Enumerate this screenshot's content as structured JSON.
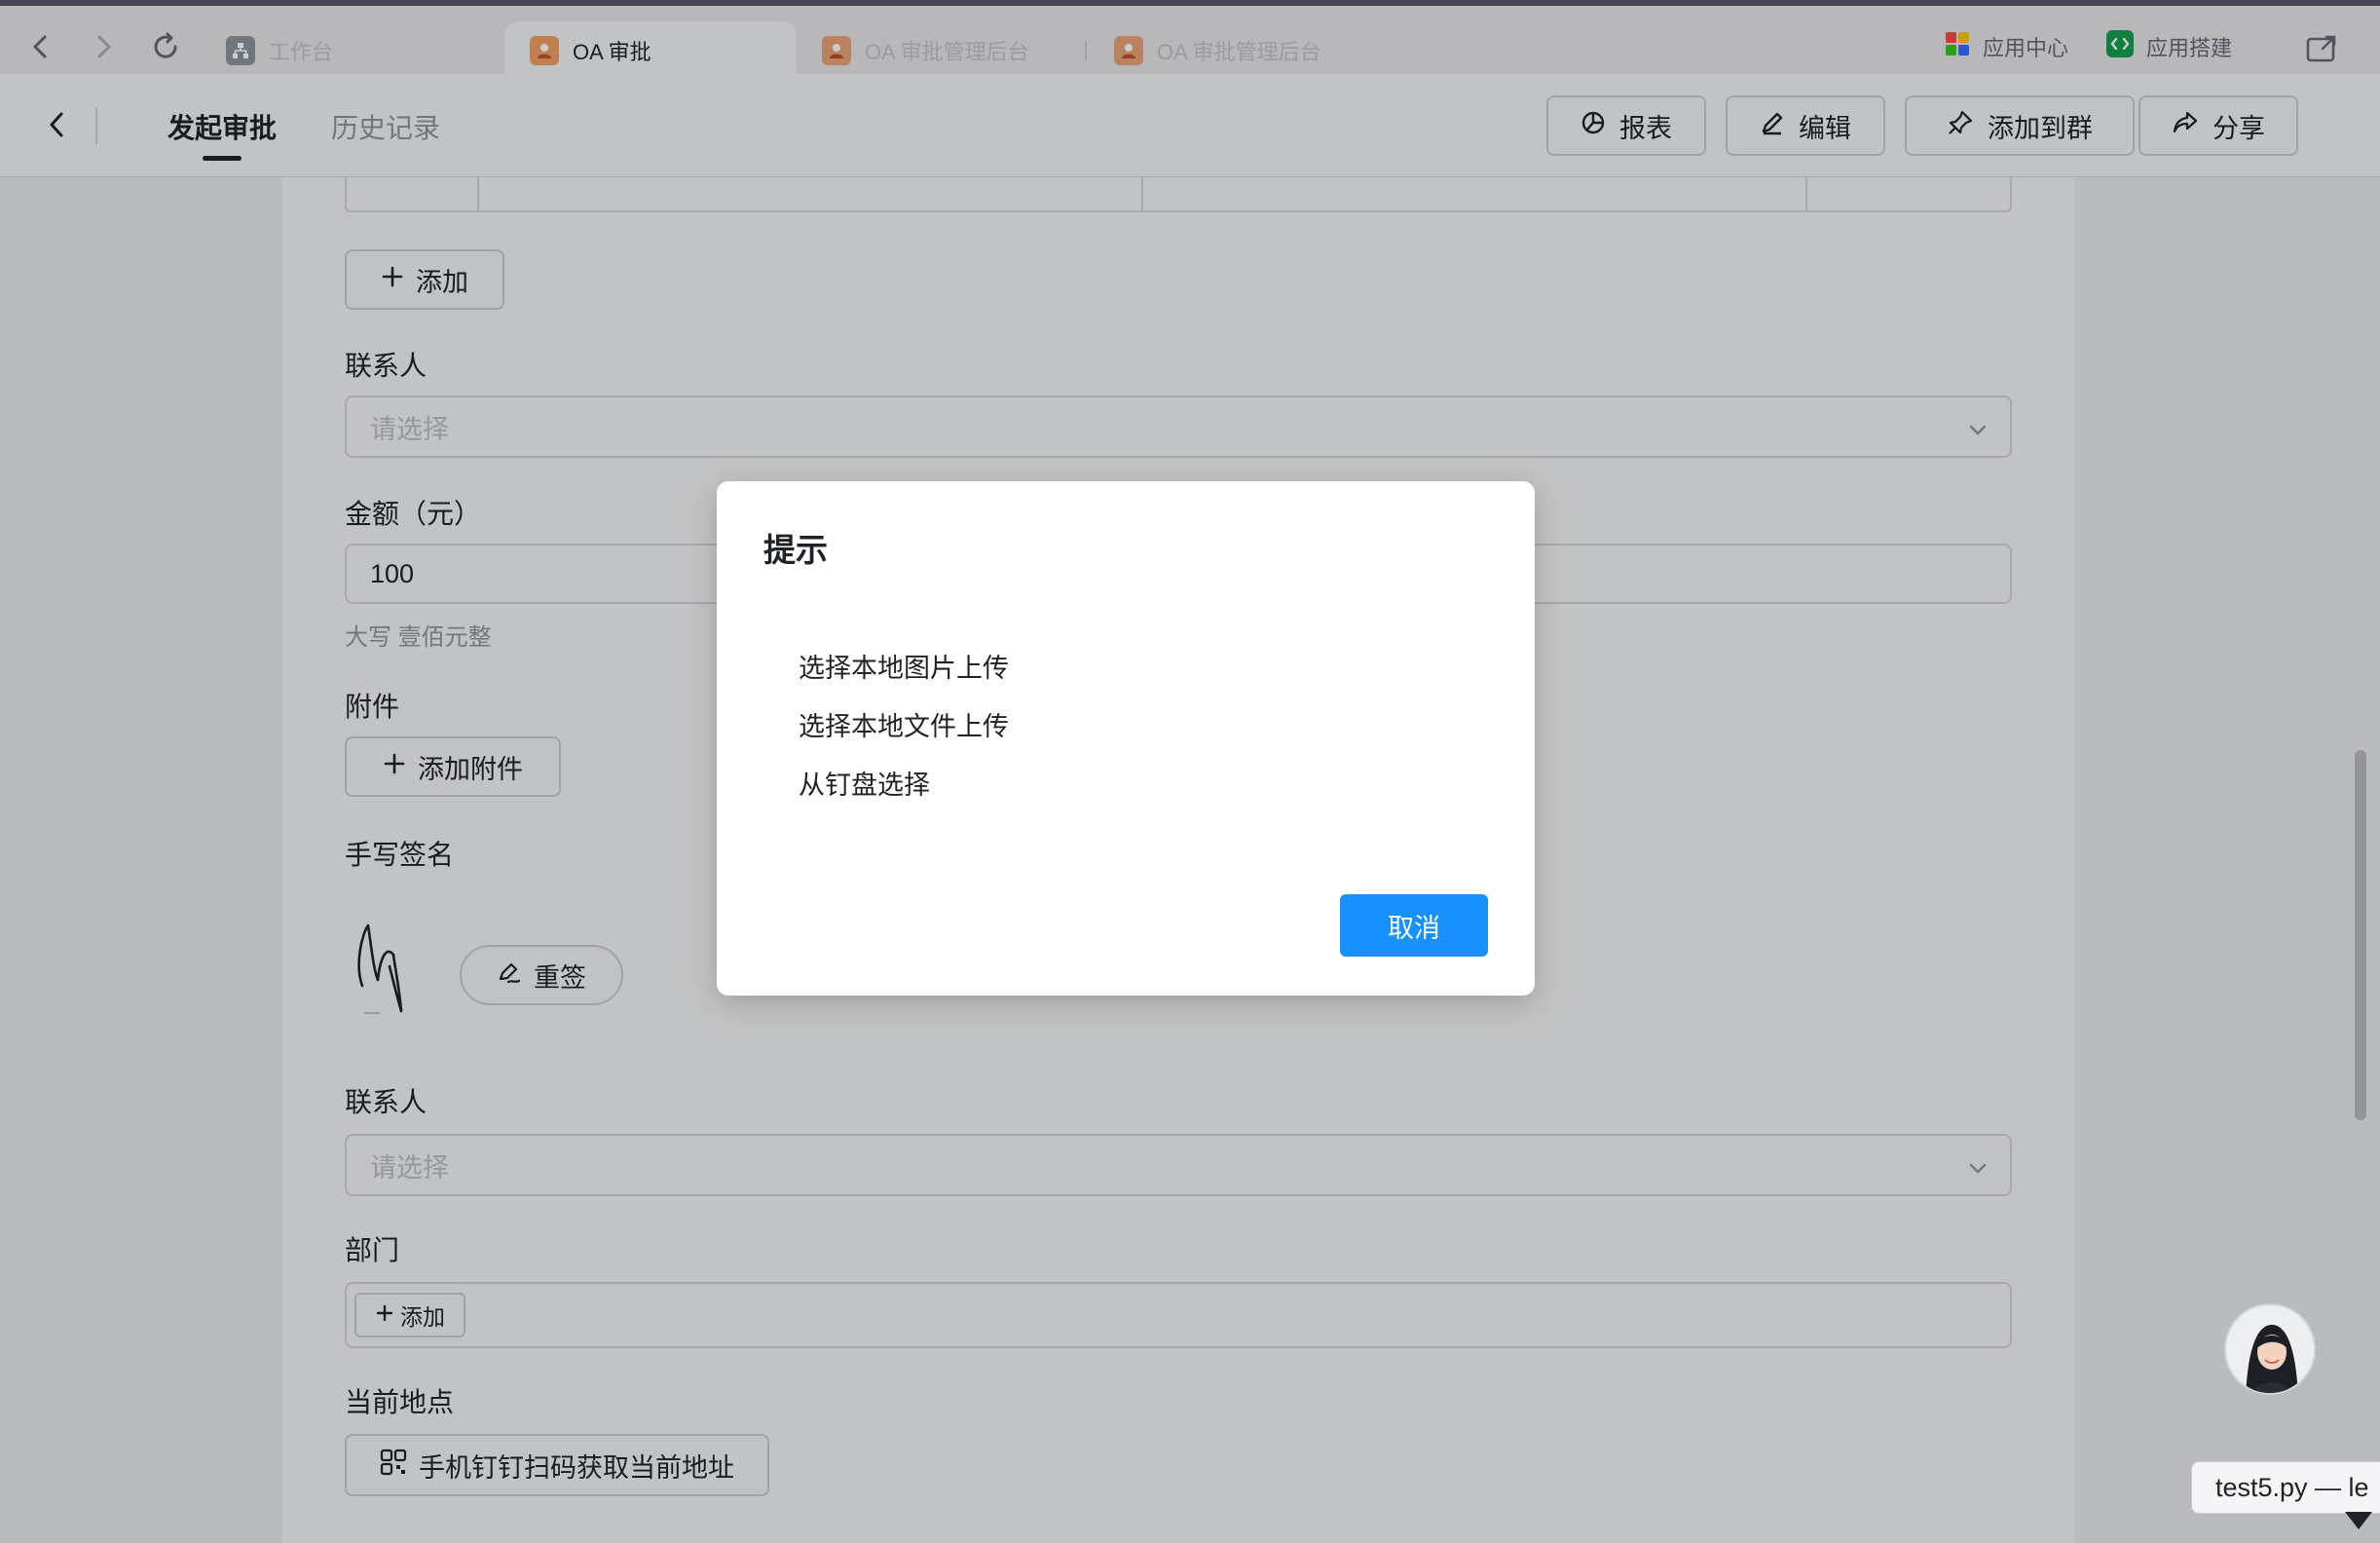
{
  "browser": {
    "tabs": [
      {
        "label": "工作台",
        "state": "inactive",
        "icon": "org-chart-icon"
      },
      {
        "label": "OA 审批",
        "state": "active",
        "icon": "person-app-icon"
      },
      {
        "label": "OA 审批管理后台",
        "state": "inactive",
        "icon": "person-app-icon"
      },
      {
        "label": "OA 审批管理后台",
        "state": "inactive",
        "icon": "person-app-icon"
      }
    ],
    "app_center_label": "应用中心",
    "app_builder_label": "应用搭建"
  },
  "header": {
    "tabs": [
      {
        "label": "发起审批",
        "active": true
      },
      {
        "label": "历史记录",
        "active": false
      }
    ],
    "buttons": {
      "report": "报表",
      "edit": "编辑",
      "add_to_group": "添加到群",
      "share": "分享"
    }
  },
  "form": {
    "add_row_label": "添加",
    "contact1": {
      "label": "联系人",
      "placeholder": "请选择"
    },
    "amount": {
      "label": "金额（元）",
      "value": "100",
      "uppercase_hint": "大写 壹佰元整"
    },
    "attachment": {
      "label": "附件",
      "button": "添加附件"
    },
    "signature": {
      "label": "手写签名",
      "resign_button": "重签"
    },
    "contact2": {
      "label": "联系人",
      "placeholder": "请选择"
    },
    "department": {
      "label": "部门",
      "add_button": "添加"
    },
    "location": {
      "label": "当前地点",
      "scan_button": "手机钉钉扫码获取当前地址"
    }
  },
  "modal": {
    "title": "提示",
    "options": [
      "选择本地图片上传",
      "选择本地文件上传",
      "从钉盘选择"
    ],
    "cancel": "取消"
  },
  "tooltip": {
    "text": "test5.py — le"
  },
  "colors": {
    "primary": "#1890ff",
    "text": "#1f2329",
    "muted": "#8f959e",
    "border": "#d0d3d8"
  }
}
